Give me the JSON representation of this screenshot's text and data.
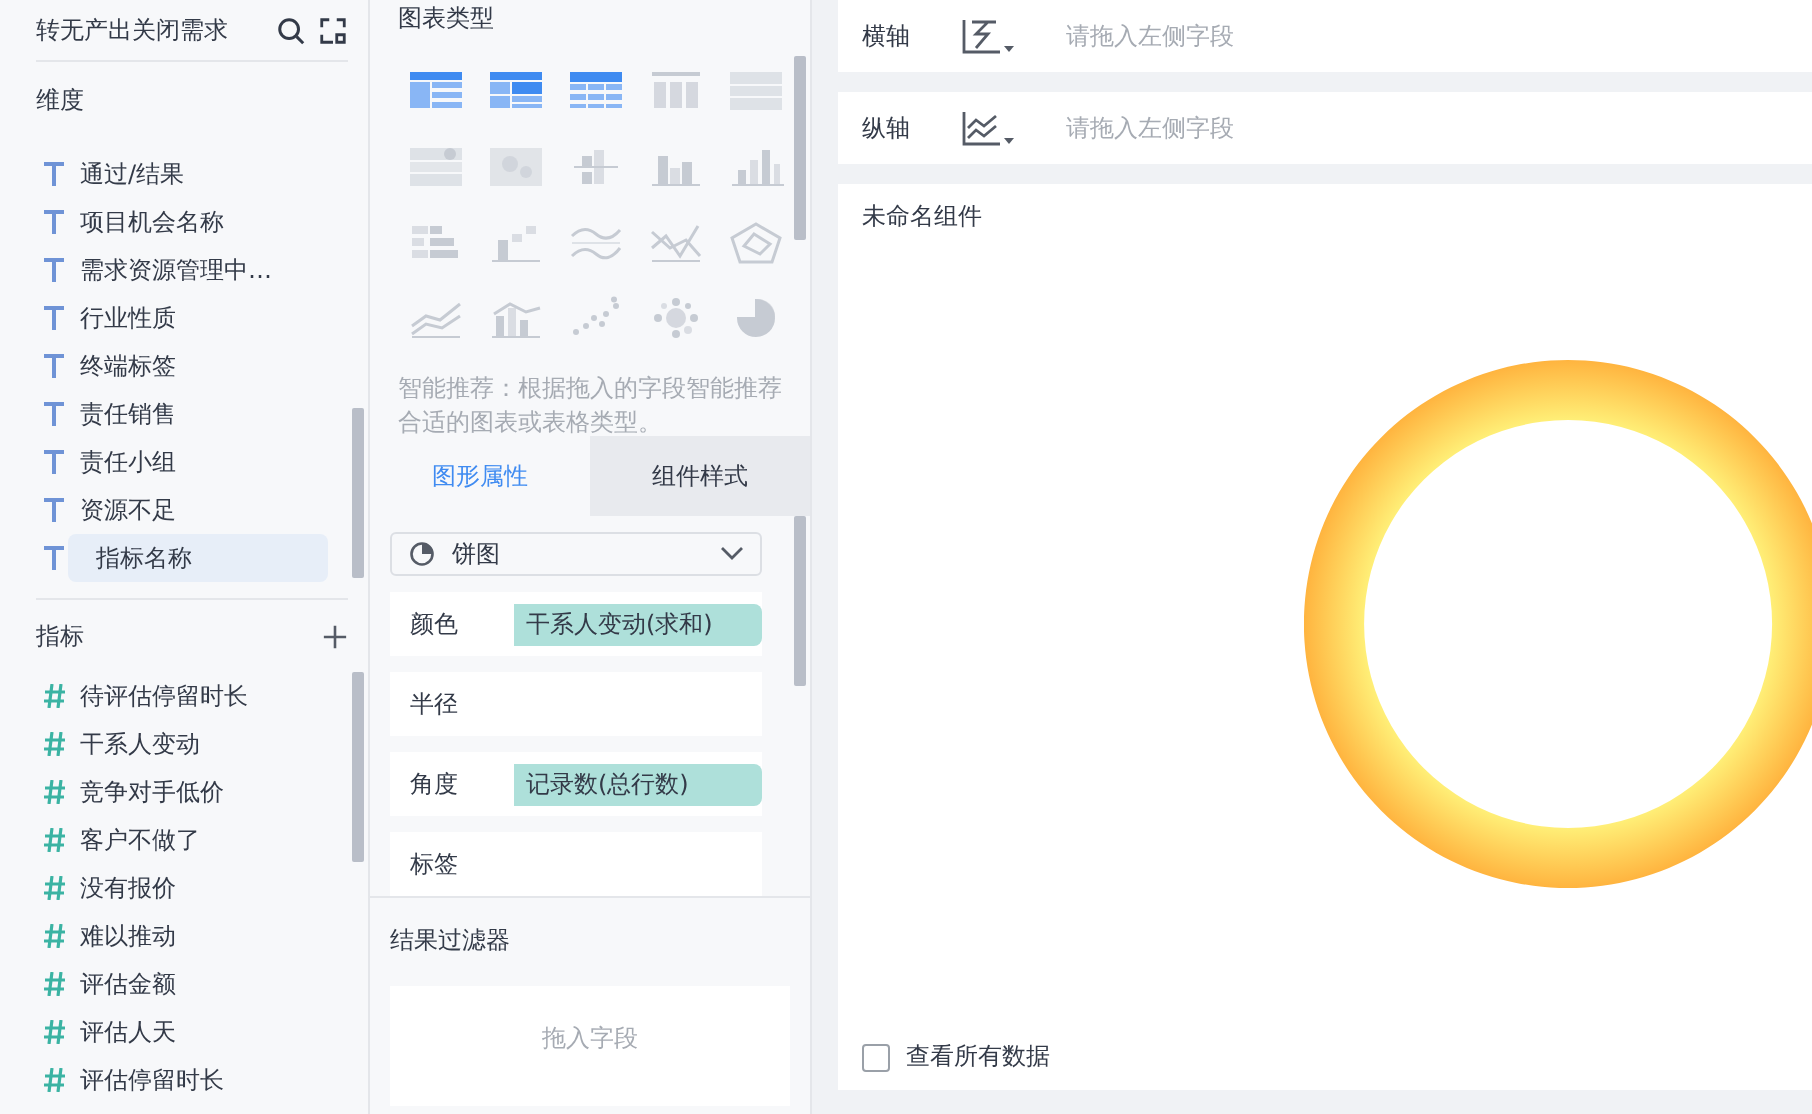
{
  "fields_panel": {
    "title": "转无产出关闭需求",
    "dimensions": {
      "title": "维度",
      "items": [
        {
          "label": "通过/结果",
          "selected": false
        },
        {
          "label": "项目机会名称",
          "selected": false
        },
        {
          "label": "需求资源管理中…",
          "selected": false
        },
        {
          "label": "行业性质",
          "selected": false
        },
        {
          "label": "终端标签",
          "selected": false
        },
        {
          "label": "责任销售",
          "selected": false
        },
        {
          "label": "责任小组",
          "selected": false
        },
        {
          "label": "资源不足",
          "selected": false
        },
        {
          "label": "指标名称",
          "selected": true
        }
      ]
    },
    "measures": {
      "title": "指标",
      "items": [
        {
          "label": "待评估停留时长"
        },
        {
          "label": "干系人变动"
        },
        {
          "label": "竞争对手低价"
        },
        {
          "label": "客户不做了"
        },
        {
          "label": "没有报价"
        },
        {
          "label": "难以推动"
        },
        {
          "label": "评估金额"
        },
        {
          "label": "评估人天"
        },
        {
          "label": "评估停留时长"
        }
      ]
    }
  },
  "chart_types": {
    "title": "图表类型",
    "items": [
      {
        "kind": "table",
        "disabled": false
      },
      {
        "kind": "cross-table",
        "disabled": false
      },
      {
        "kind": "detail-table",
        "disabled": false
      },
      {
        "kind": "kpi",
        "disabled": true
      },
      {
        "kind": "kpi-list",
        "disabled": true
      },
      {
        "kind": "card-list",
        "disabled": true
      },
      {
        "kind": "heatmap",
        "disabled": true
      },
      {
        "kind": "grouped-bar",
        "disabled": true
      },
      {
        "kind": "stacked-bar",
        "disabled": true
      },
      {
        "kind": "bar",
        "disabled": true
      },
      {
        "kind": "bar-h",
        "disabled": true
      },
      {
        "kind": "step",
        "disabled": true
      },
      {
        "kind": "multi-line",
        "disabled": true
      },
      {
        "kind": "line",
        "disabled": true
      },
      {
        "kind": "radar",
        "disabled": true
      },
      {
        "kind": "area",
        "disabled": true
      },
      {
        "kind": "combo",
        "disabled": true
      },
      {
        "kind": "scatter",
        "disabled": true
      },
      {
        "kind": "bubble",
        "disabled": true
      },
      {
        "kind": "pie",
        "disabled": true
      }
    ],
    "hint": "智能推荐：根据拖入的字段智能推荐合适的图表或表格类型。"
  },
  "tabs": [
    {
      "label": "图形属性",
      "selected": true
    },
    {
      "label": "组件样式",
      "selected": false
    }
  ],
  "chart_select": {
    "value": "饼图"
  },
  "properties": [
    {
      "label": "颜色",
      "chip": "干系人变动(求和)"
    },
    {
      "label": "半径"
    },
    {
      "label": "角度",
      "chip": "记录数(总行数)"
    },
    {
      "label": "标签"
    }
  ],
  "result_filter": {
    "title": "结果过滤器",
    "placeholder": "拖入字段"
  },
  "axes": [
    {
      "label": "横轴",
      "kind": "x",
      "placeholder": "请拖入左侧字段"
    },
    {
      "label": "纵轴",
      "kind": "y",
      "placeholder": "请拖入左侧字段"
    }
  ],
  "canvas": {
    "title": "未命名组件",
    "show_all": {
      "label": "查看所有数据",
      "checked": false
    }
  }
}
